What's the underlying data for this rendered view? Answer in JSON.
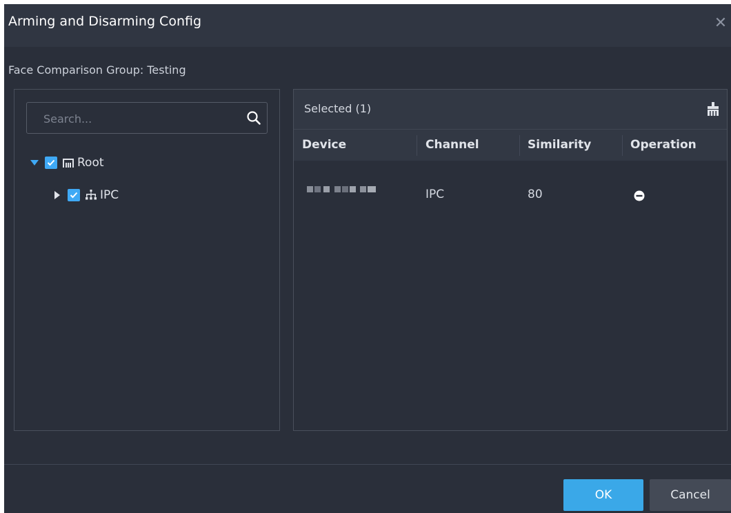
{
  "dialog": {
    "title": "Arming and Disarming Config",
    "close_icon": "close-icon",
    "group_label": "Face Comparison Group:",
    "group_value": "Testing"
  },
  "tree": {
    "search_placeholder": "Search...",
    "nodes": [
      {
        "label": "Root",
        "expanded": true,
        "checked": true,
        "icon": "org-root-icon"
      },
      {
        "label": "IPC",
        "expanded": false,
        "checked": true,
        "icon": "device-tree-icon"
      }
    ]
  },
  "selected": {
    "label": "Selected (1)",
    "columns": [
      "Device",
      "Channel",
      "Similarity",
      "Operation"
    ],
    "rows": [
      {
        "device": "",
        "channel": "IPC",
        "similarity": "80",
        "operation": "remove-icon"
      }
    ]
  },
  "footer": {
    "ok_label": "OK",
    "cancel_label": "Cancel"
  },
  "colors": {
    "background": "#2a2f3a",
    "accent": "#3aa8e8",
    "checkbox": "#3fa9f5"
  }
}
